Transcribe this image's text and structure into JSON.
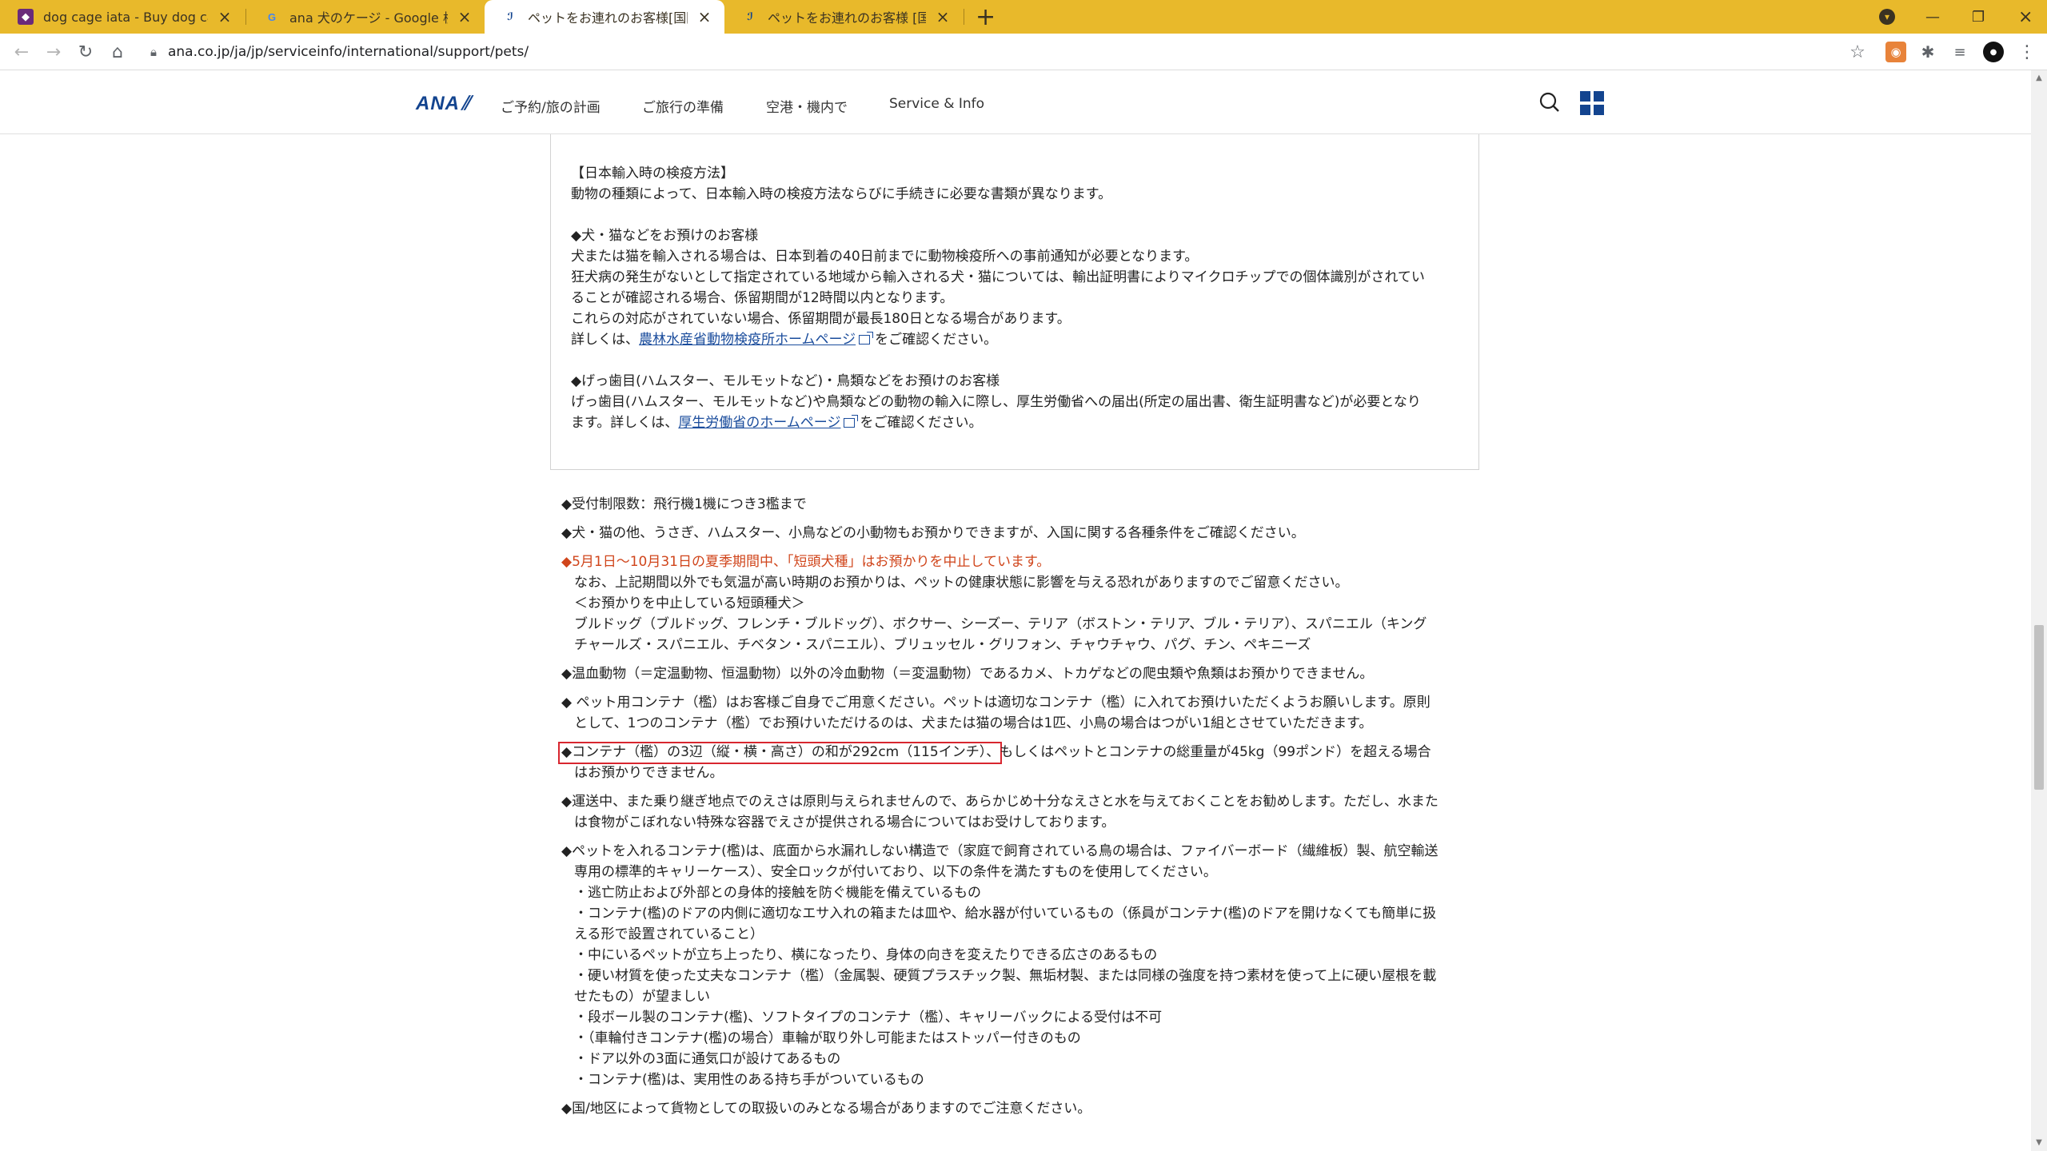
{
  "browser": {
    "tabs": [
      {
        "title": "dog cage iata - Buy dog cage iat",
        "favicon": "shop-icon",
        "active": false
      },
      {
        "title": "ana 犬のケージ - Google 検索",
        "favicon": "google-icon",
        "active": false
      },
      {
        "title": "ペットをお連れのお客様[国際線] | Se",
        "favicon": "ana-icon",
        "active": true
      },
      {
        "title": "ペットをお連れのお客様 [国内線] | S",
        "favicon": "ana-icon",
        "active": false
      }
    ],
    "url": "ana.co.jp/ja/jp/serviceinfo/international/support/pets/",
    "colors": {
      "tabbar": "#e8b92b"
    }
  },
  "site": {
    "logo": "ANA",
    "nav": [
      "ご予約/旅の計画",
      "ご旅行の準備",
      "空港・機内で",
      "Service & Info"
    ]
  },
  "box": {
    "heading": "【日本輸入時の検疫方法】",
    "intro": "動物の種類によって、日本輸入時の検疫方法ならびに手続きに必要な書類が異なります。",
    "dogcat_heading": "◆犬・猫などをお預けのお客様",
    "dogcat_1": "犬または猫を輸入される場合は、日本到着の40日前までに動物検疫所への事前通知が必要となります。",
    "dogcat_2": "狂犬病の発生がないとして指定されている地域から輸入される犬・猫については、輸出証明書によりマイクロチップでの個体識別がされてい",
    "dogcat_3": "ることが確認される場合、係留期間が12時間以内となります。",
    "dogcat_4": "これらの対応がされていない場合、係留期間が最長180日となる場合があります。",
    "dogcat_5_pre": "詳しくは、",
    "dogcat_5_link": "農林水産省動物検疫所ホームページ",
    "dogcat_5_post": "をご確認ください。",
    "rodent_heading": "◆げっ歯目(ハムスター、モルモットなど)・鳥類などをお預けのお客様",
    "rodent_1": "げっ歯目(ハムスター、モルモットなど)や鳥類などの動物の輸入に際し、厚生労働省への届出(所定の届出書、衛生証明書など)が必要となり",
    "rodent_2_pre": "ます。詳しくは、",
    "rodent_2_link": "厚生労働省のホームページ",
    "rodent_2_post": "をご確認ください。"
  },
  "list": {
    "limit": "◆受付制限数：飛行機1機につき3檻まで",
    "small_animals": "◆犬・猫の他、うさぎ、ハムスター、小鳥などの小動物もお預かりできますが、入国に関する各種条件をご確認ください。",
    "summer_red": "◆5月1日～10月31日の夏季期間中、「短頭犬種」はお預かりを中止しています。",
    "summer_2": "なお、上記期間以外でも気温が高い時期のお預かりは、ペットの健康状態に影響を与える恐れがありますのでご留意ください。",
    "summer_3": "＜お預かりを中止している短頭種犬＞",
    "summer_4": "ブルドッグ（ブルドッグ、フレンチ・ブルドッグ）、ボクサー、シーズー、テリア（ボストン・テリア、ブル・テリア）、スパニエル（キング",
    "summer_5": "チャールズ・スパニエル、チベタン・スパニエル）、ブリュッセル・グリフォン、チャウチャウ、パグ、チン、ペキニーズ",
    "coldblood": "◆温血動物（＝定温動物、恒温動物）以外の冷血動物（＝変温動物）であるカメ、トカゲなどの爬虫類や魚類はお預かりできません。",
    "container_1": "◆ ペット用コンテナ（檻）はお客様ご自身でご用意ください。ペットは適切なコンテナ（檻）に入れてお預けいただくようお願いします。原則",
    "container_2": "として、1つのコンテナ（檻）でお預けいただけるのは、犬または猫の場合は1匹、小鳥の場合はつがい1組とさせていただきます。",
    "size_highlight": "◆コンテナ（檻）の3辺（縦・横・高さ）の和が292cm（115インチ）",
    "size_rest": "、もしくはペットとコンテナの総重量が45kg（99ポンド）を超える場合",
    "size_2": "はお預かりできません。",
    "food_1": "◆運送中、また乗り継ぎ地点でのえさは原則与えられませんので、あらかじめ十分なえさと水を与えておくことをお勧めします。ただし、水また",
    "food_2": "は食物がこぼれない特殊な容器でえさが提供される場合についてはお受けしております。",
    "req_1": "◆ペットを入れるコンテナ(檻)は、底面から水漏れしない構造で（家庭で飼育されている鳥の場合は、ファイバーボード（繊維板）製、航空輸送",
    "req_2": "専用の標準的キャリーケース）、安全ロックが付いており、以下の条件を満たすものを使用してください。",
    "req_3": "・逃亡防止および外部との身体的接触を防ぐ機能を備えているもの",
    "req_4": "・コンテナ(檻)のドアの内側に適切なエサ入れの箱または皿や、給水器が付いているもの（係員がコンテナ(檻)のドアを開けなくても簡単に扱",
    "req_5": "える形で設置されていること）",
    "req_6": "・中にいるペットが立ち上ったり、横になったり、身体の向きを変えたりできる広さのあるもの",
    "req_7": "・硬い材質を使った丈夫なコンテナ（檻）（金属製、硬質プラスチック製、無垢材製、または同様の強度を持つ素材を使って上に硬い屋根を載",
    "req_8": "せたもの）が望ましい",
    "req_9": "・段ボール製のコンテナ(檻)、ソフトタイプのコンテナ（檻）、キャリーバックによる受付は不可",
    "req_10": "・（車輪付きコンテナ(檻)の場合）車輪が取り外し可能またはストッパー付きのもの",
    "req_11": "・ドア以外の3面に通気口が設けてあるもの",
    "req_12": "・コンテナ(檻)は、実用性のある持ち手がついているもの",
    "country": "◆国/地区によって貨物としての取扱いのみとなる場合がありますのでご注意ください。"
  }
}
